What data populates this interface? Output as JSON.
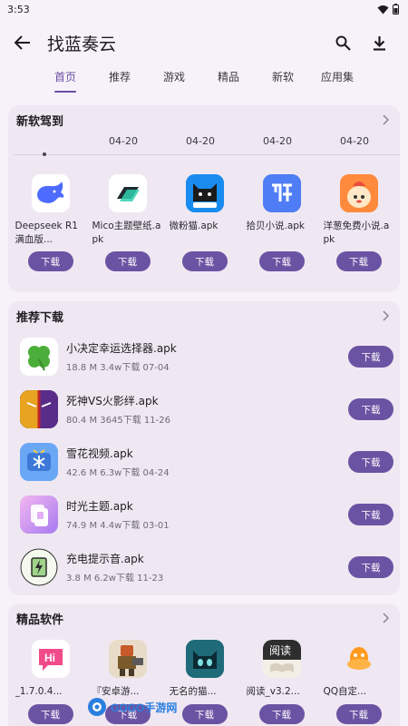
{
  "status": {
    "time": "3:53"
  },
  "app": {
    "title": "找蓝奏云"
  },
  "tabs": [
    "首页",
    "推荐",
    "游戏",
    "精品",
    "新软",
    "应用集"
  ],
  "new_software": {
    "title": "新软驾到",
    "dates": [
      "04-20",
      "04-20",
      "04-20",
      "04-20"
    ],
    "items": [
      {
        "name": "Deepseek R1满血版...",
        "button": "下载",
        "icon": "whale-icon"
      },
      {
        "name": "Mico主题壁纸.apk",
        "button": "下载",
        "icon": "layers-icon"
      },
      {
        "name": "微粉猫.apk",
        "button": "下载",
        "icon": "cat-icon"
      },
      {
        "name": "拾贝小说.apk",
        "button": "下载",
        "icon": "book-icon"
      },
      {
        "name": "洋葱免费小说.apk",
        "button": "下载",
        "icon": "onion-icon"
      }
    ]
  },
  "recommend": {
    "title": "推荐下载",
    "items": [
      {
        "name": "小决定幸运选择器.apk",
        "meta": "18.8 M  3.4w下载  07-04",
        "button": "下载",
        "icon": "clover-icon"
      },
      {
        "name": "死神VS火影绊.apk",
        "meta": "80.4 M  3645下载  11-26",
        "button": "下载",
        "icon": "anime-icon"
      },
      {
        "name": "雪花视频.apk",
        "meta": "42.6 M  6.3w下载  04-24",
        "button": "下载",
        "icon": "snowflake-tv-icon"
      },
      {
        "name": "时光主题.apk",
        "meta": "74.9 M  4.4w下载  03-01",
        "button": "下载",
        "icon": "theme-icon"
      },
      {
        "name": "充电提示音.apk",
        "meta": "3.8 M  6.2w下载  11-23",
        "button": "下载",
        "icon": "charge-icon"
      }
    ]
  },
  "featured": {
    "title": "精品软件",
    "items": [
      {
        "name": "_1.7.0.4...",
        "button": "下载",
        "icon": "hi-icon"
      },
      {
        "name": "『安卓游...",
        "button": "下载",
        "icon": "robot-icon"
      },
      {
        "name": "无名的猫...",
        "button": "下载",
        "icon": "cat-game-icon"
      },
      {
        "name": "阅读_v3.2...",
        "button": "下载",
        "icon": "reader-icon"
      },
      {
        "name": "QQ自定...",
        "button": "下载",
        "icon": "qq-icon"
      }
    ]
  },
  "watermark": {
    "text": "GOGO手游网"
  },
  "colors": {
    "accent": "#6b53a3",
    "background": "#f7f2fa",
    "card": "#efe8f2"
  }
}
